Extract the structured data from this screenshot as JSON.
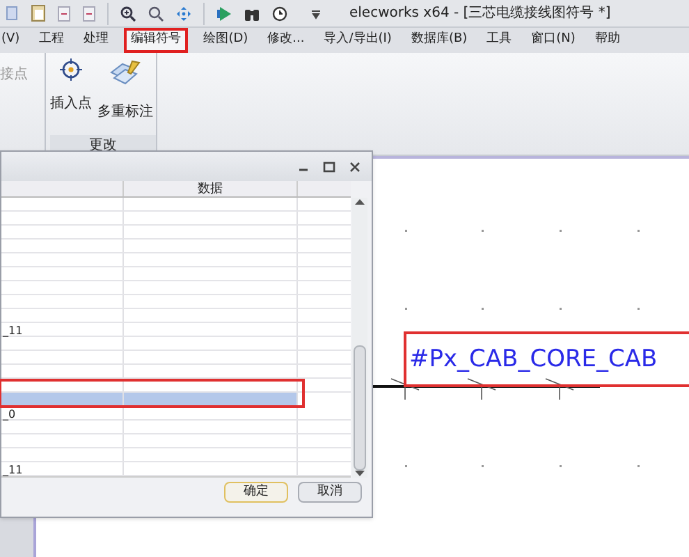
{
  "window": {
    "title": "elecworks x64 - [三芯电缆接线图符号 *]"
  },
  "menu": [
    {
      "label": "(V)",
      "selected": false
    },
    {
      "label": "工程",
      "selected": false
    },
    {
      "label": "处理",
      "selected": false
    },
    {
      "label": "编辑符号",
      "selected": true
    },
    {
      "label": "绘图(D)",
      "selected": false
    },
    {
      "label": "修改...",
      "selected": false
    },
    {
      "label": "导入/导出(I)",
      "selected": false
    },
    {
      "label": "数据库(B)",
      "selected": false
    },
    {
      "label": "工具",
      "selected": false
    },
    {
      "label": "窗口(N)",
      "selected": false
    },
    {
      "label": "帮助",
      "selected": false
    }
  ],
  "ribbon": {
    "partial_group": {
      "label": "接点",
      "disabled": true
    },
    "group": {
      "label": "更改",
      "buttons": [
        {
          "label": "插入点",
          "kind": "insert-point"
        },
        {
          "label": "多重标注",
          "kind": "multi-label"
        }
      ]
    }
  },
  "dialog": {
    "columns": [
      "数据"
    ],
    "rows": [
      {
        "selected": false
      },
      {
        "selected": false
      },
      {
        "selected": false
      },
      {
        "selected": false
      },
      {
        "selected": false
      },
      {
        "selected": false
      },
      {
        "selected": false
      },
      {
        "selected": false
      },
      {
        "selected": false
      },
      {
        "selected": false,
        "name": "_11"
      },
      {
        "selected": false
      },
      {
        "selected": false
      },
      {
        "selected": false
      },
      {
        "selected": false
      },
      {
        "selected": true
      },
      {
        "selected": false,
        "name": "_0"
      },
      {
        "selected": false
      },
      {
        "selected": false
      },
      {
        "selected": false
      },
      {
        "selected": false,
        "name": "_11"
      }
    ],
    "buttons": [
      "确定",
      "取消"
    ]
  },
  "canvas": {
    "label": "#Px_CAB_CORE_CAB"
  }
}
